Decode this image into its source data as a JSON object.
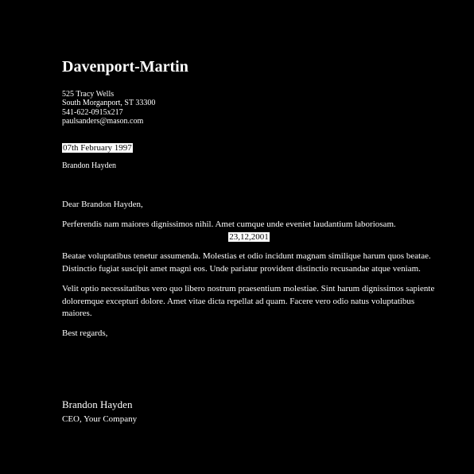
{
  "letterhead": {
    "company": "Davenport-Martin",
    "address_lines": [
      "525 Tracy Wells",
      "South Morganport, ST 33300",
      "541-622-0915x217",
      "paulsanders@mason.com"
    ]
  },
  "letter": {
    "date": "07th February 1997",
    "recipient": "Brandon Hayden",
    "salutation": "Dear Brandon Hayden,",
    "paragraph1": "Perferendis nam maiores dignissimos nihil. Amet cumque unde eveniet laudantium laboriosam.",
    "inline_date": "23,12,2001",
    "paragraph2": "Beatae voluptatibus tenetur assumenda. Molestias et odio incidunt magnam similique harum quos beatae. Distinctio fugiat suscipit amet magni eos. Unde pariatur provident distinctio recusandae atque veniam.",
    "paragraph3": "Velit optio necessitatibus vero quo libero nostrum praesentium molestiae. Sint harum dignissimos sapiente doloremque excepturi dolore. Amet vitae dicta repellat ad quam. Facere vero odio natus voluptatibus maiores.",
    "closing": "Best regards,"
  },
  "signature": {
    "name": "Brandon Hayden",
    "title": "CEO, Your Company"
  },
  "colors": {
    "background": "#000000",
    "text": "#ffffff",
    "highlight_background": "#ffffff",
    "highlight_text": "#000000"
  }
}
